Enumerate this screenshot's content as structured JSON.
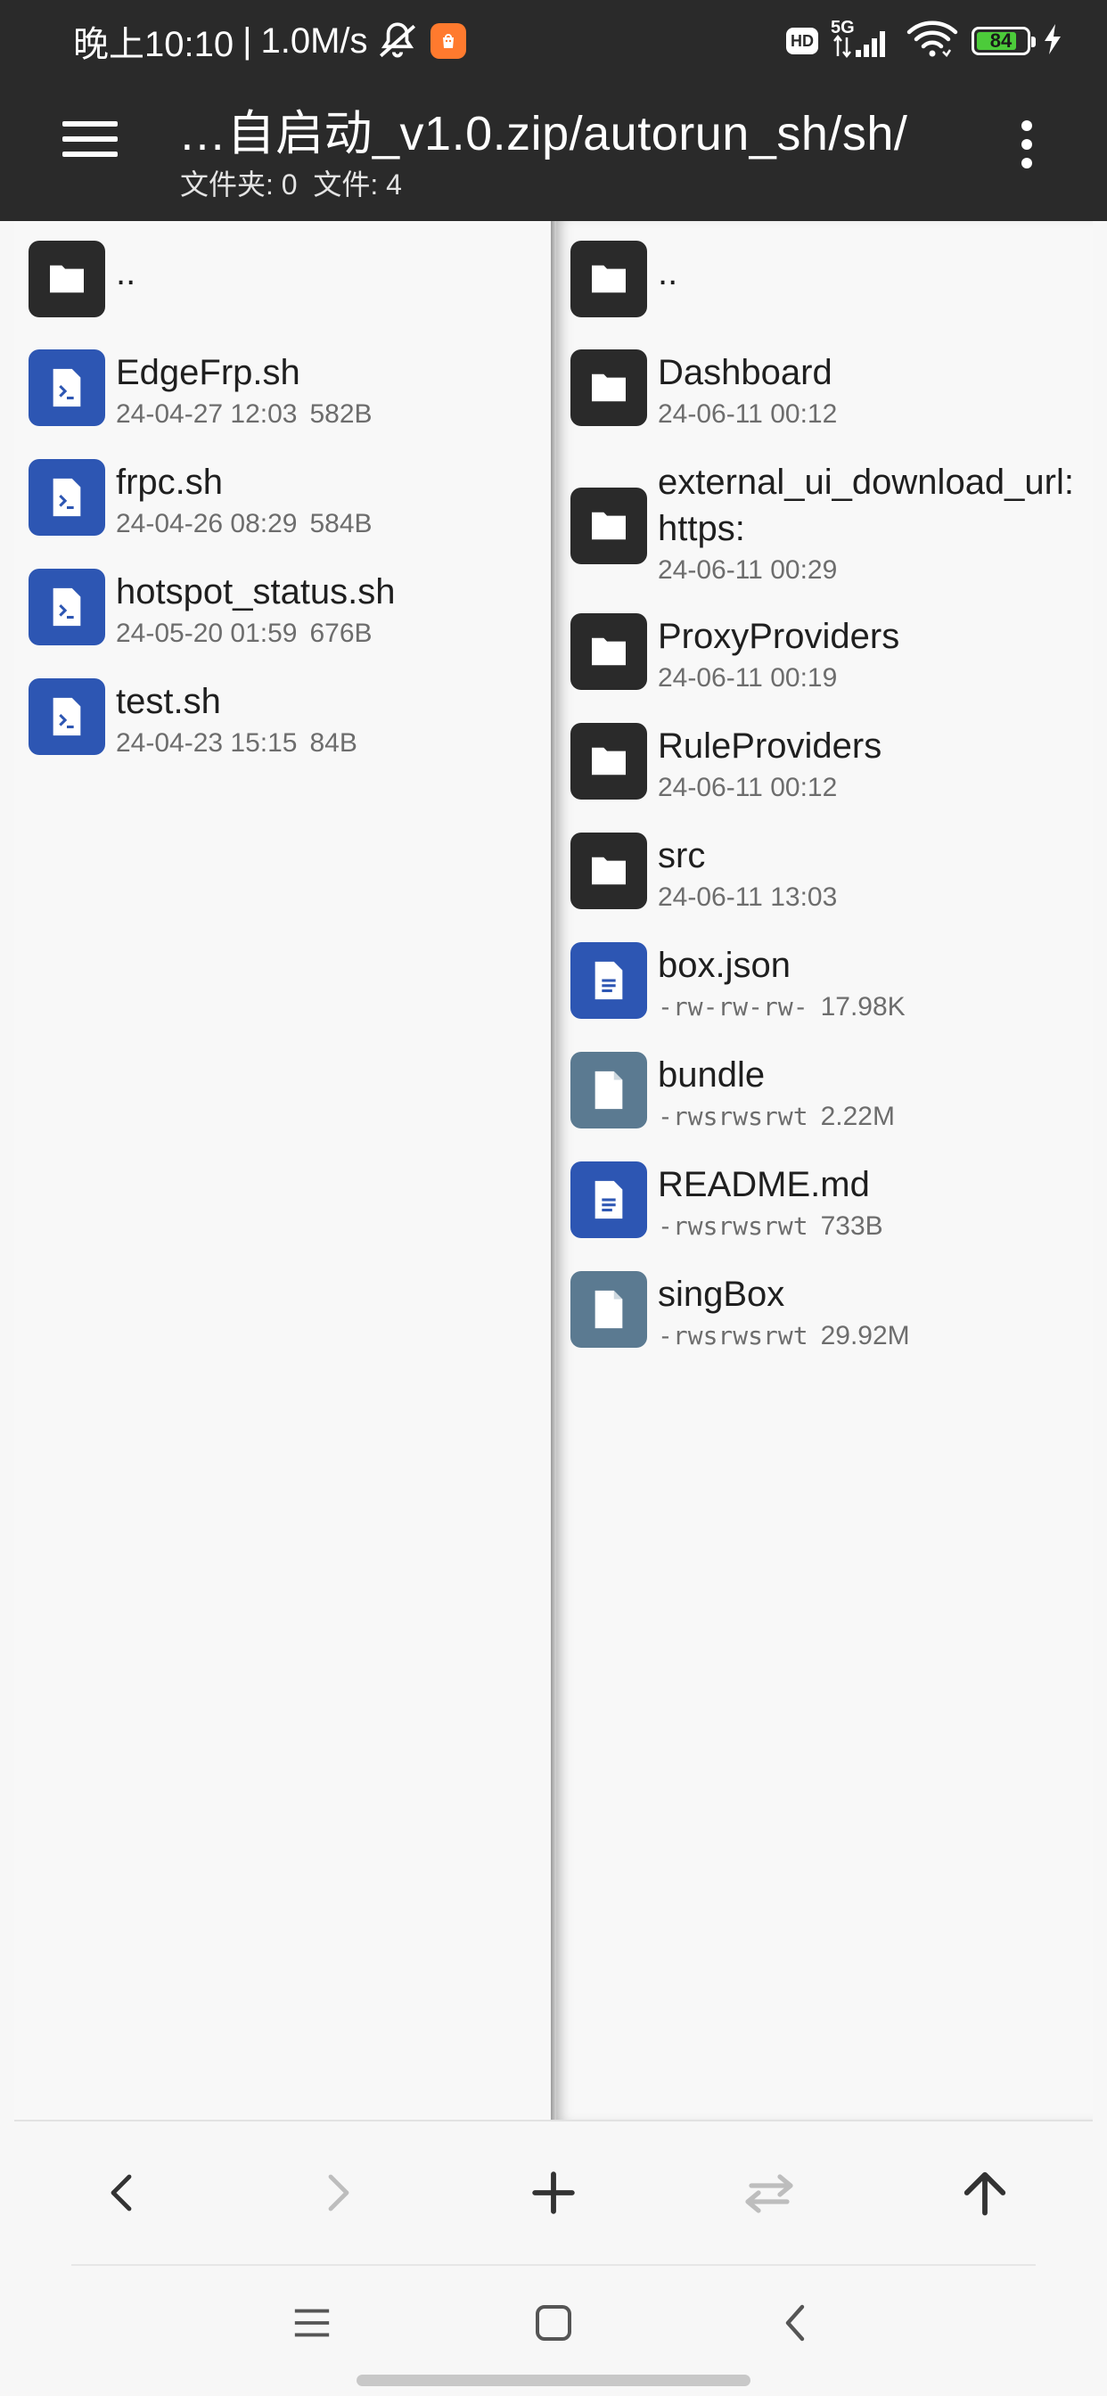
{
  "status_bar": {
    "time": "晚上10:10",
    "separator": "|",
    "net_speed": "1.0M/s",
    "hd_label": "HD",
    "network": "5G",
    "battery_level": "84",
    "battery_fraction": 0.84,
    "icons": [
      "bell-off-icon",
      "app-notification-icon",
      "hd-icon",
      "signal-icon",
      "wifi-icon",
      "battery-icon",
      "charging-icon"
    ]
  },
  "app_bar": {
    "path": "…自启动_v1.0.zip/autorun_sh/sh/",
    "counts": "文件夹: 0  文件: 4",
    "menu_icon": "hamburger-menu-icon",
    "overflow_icon": "more-vert-icon"
  },
  "left_pane": {
    "parent": "..",
    "files": [
      {
        "name": "EdgeFrp.sh",
        "date": "24-04-27 12:03",
        "size": "582B",
        "icon": "script-icon"
      },
      {
        "name": "frpc.sh",
        "date": "24-04-26 08:29",
        "size": "584B",
        "icon": "script-icon"
      },
      {
        "name": "hotspot_status.sh",
        "date": "24-05-20 01:59",
        "size": "676B",
        "icon": "script-icon"
      },
      {
        "name": "test.sh",
        "date": "24-04-23 15:15",
        "size": "84B",
        "icon": "script-icon"
      }
    ]
  },
  "right_pane": {
    "parent": "..",
    "folders": [
      {
        "name": "Dashboard",
        "date": "24-06-11 00:12"
      },
      {
        "name_line1": "external_ui_download_url:",
        "name_line2": "https:",
        "date": "24-06-11 00:29"
      },
      {
        "name": "ProxyProviders",
        "date": "24-06-11 00:19"
      },
      {
        "name": "RuleProviders",
        "date": "24-06-11 00:12"
      },
      {
        "name": "src",
        "date": "24-06-11 13:03"
      }
    ],
    "files": [
      {
        "name": "box.json",
        "perm": "-rw-rw-rw-",
        "size": "17.98K",
        "icon": "text-file-icon"
      },
      {
        "name": "bundle",
        "perm": "-rwsrwsrwt",
        "size": "2.22M",
        "icon": "binary-file-icon"
      },
      {
        "name": "README.md",
        "perm": "-rwsrwsrwt",
        "size": "733B",
        "icon": "text-file-icon"
      },
      {
        "name": "singBox",
        "perm": "-rwsrwsrwt",
        "size": "29.92M",
        "icon": "binary-file-icon"
      }
    ]
  },
  "toolbar": {
    "buttons": [
      "back-icon",
      "forward-icon",
      "add-icon",
      "swap-icon",
      "up-icon"
    ]
  },
  "system_nav": {
    "buttons": [
      "recents-icon",
      "home-icon",
      "system-back-icon"
    ]
  },
  "colors": {
    "app_bar": "#2a2a2a",
    "folder_icon_bg": "#2a2a2a",
    "script_icon_bg": "#2d56b3",
    "text_file_icon_bg": "#2d56b3",
    "binary_file_icon_bg": "#5b7a91",
    "battery_fill": "#4ccb3a",
    "notification_badge": "#ff7a2e"
  }
}
